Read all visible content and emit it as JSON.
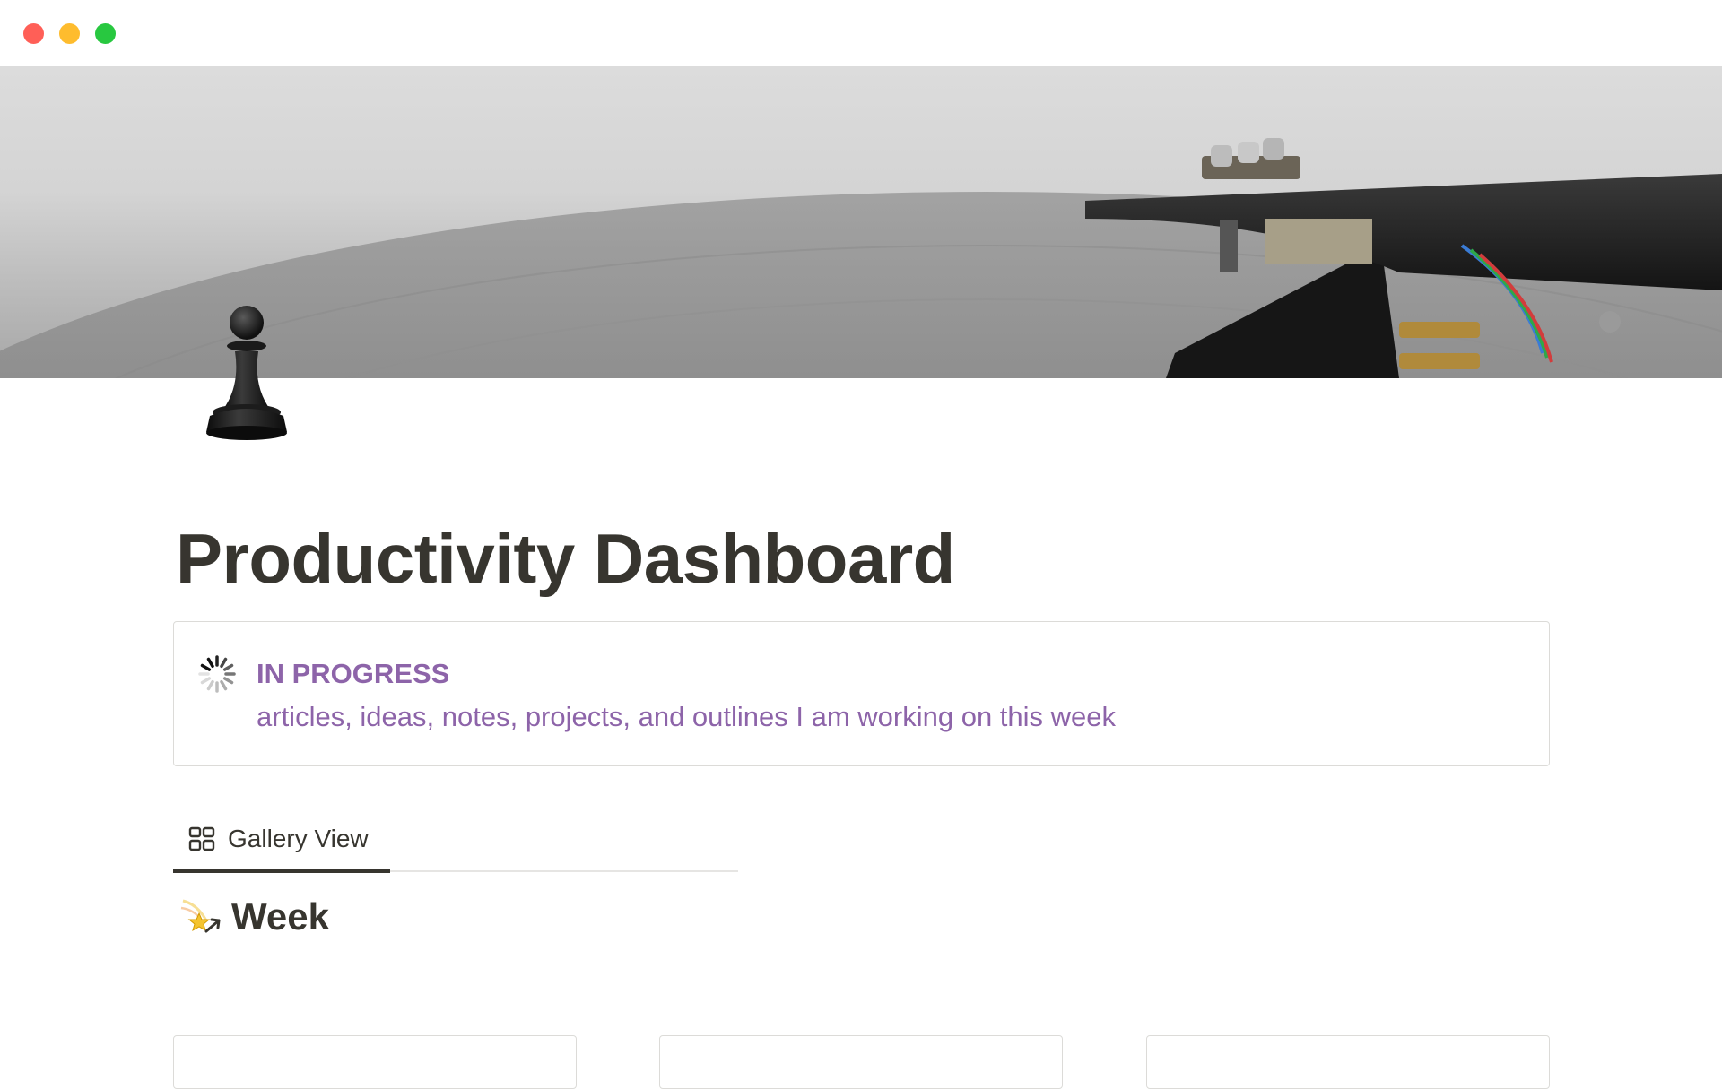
{
  "window": {
    "controls": [
      "close",
      "minimize",
      "maximize"
    ],
    "colors": {
      "close": "#ff5f57",
      "minimize": "#febc2e",
      "maximize": "#28c840"
    }
  },
  "page": {
    "icon": "chess-pawn-icon",
    "title": "Productivity Dashboard"
  },
  "callout": {
    "icon": "loading-spinner-icon",
    "title": "IN PROGRESS",
    "text": "articles, ideas, notes, projects, and outlines I am working on this week",
    "text_color": "#8d64a9"
  },
  "views": {
    "tabs": [
      {
        "label": "Gallery View",
        "icon": "gallery-grid-icon",
        "active": true
      }
    ]
  },
  "section": {
    "icon": "shooting-star-icon",
    "heading": "Week"
  },
  "gallery": {
    "cards": [
      {},
      {},
      {}
    ]
  }
}
